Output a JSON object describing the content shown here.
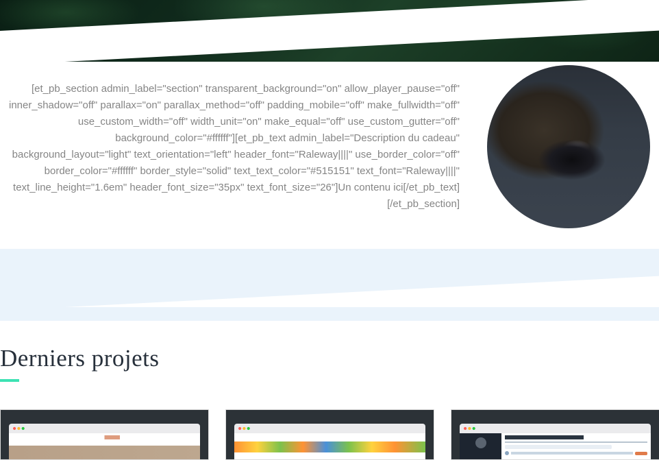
{
  "content_block": {
    "text": "[et_pb_section admin_label=\"section\" transparent_background=\"on\" allow_player_pause=\"off\" inner_shadow=\"off\" parallax=\"on\" parallax_method=\"off\" padding_mobile=\"off\" make_fullwidth=\"off\" use_custom_width=\"off\" width_unit=\"on\" make_equal=\"off\" use_custom_gutter=\"off\" background_color=\"#ffffff\"][et_pb_text admin_label=\"Description du cadeau\" background_layout=\"light\" text_orientation=\"left\" header_font=\"Raleway||||\" use_border_color=\"off\" border_color=\"#ffffff\" border_style=\"solid\" text_text_color=\"#515151\" text_font=\"Raleway||||\" text_line_height=\"1.6em\" header_font_size=\"35px\" text_font_size=\"26\"]Un contenu ici[/et_pb_text][/et_pb_section]"
  },
  "circle_image": {
    "alt": "platypus-photo"
  },
  "projects": {
    "heading": "Derniers projets",
    "cards": [
      {
        "id": "project-card-1"
      },
      {
        "id": "project-card-2"
      },
      {
        "id": "project-card-3"
      }
    ]
  },
  "colors": {
    "accent": "#3de2b3",
    "section_bg": "#eaf3fb",
    "card_bg": "#2c3237"
  }
}
